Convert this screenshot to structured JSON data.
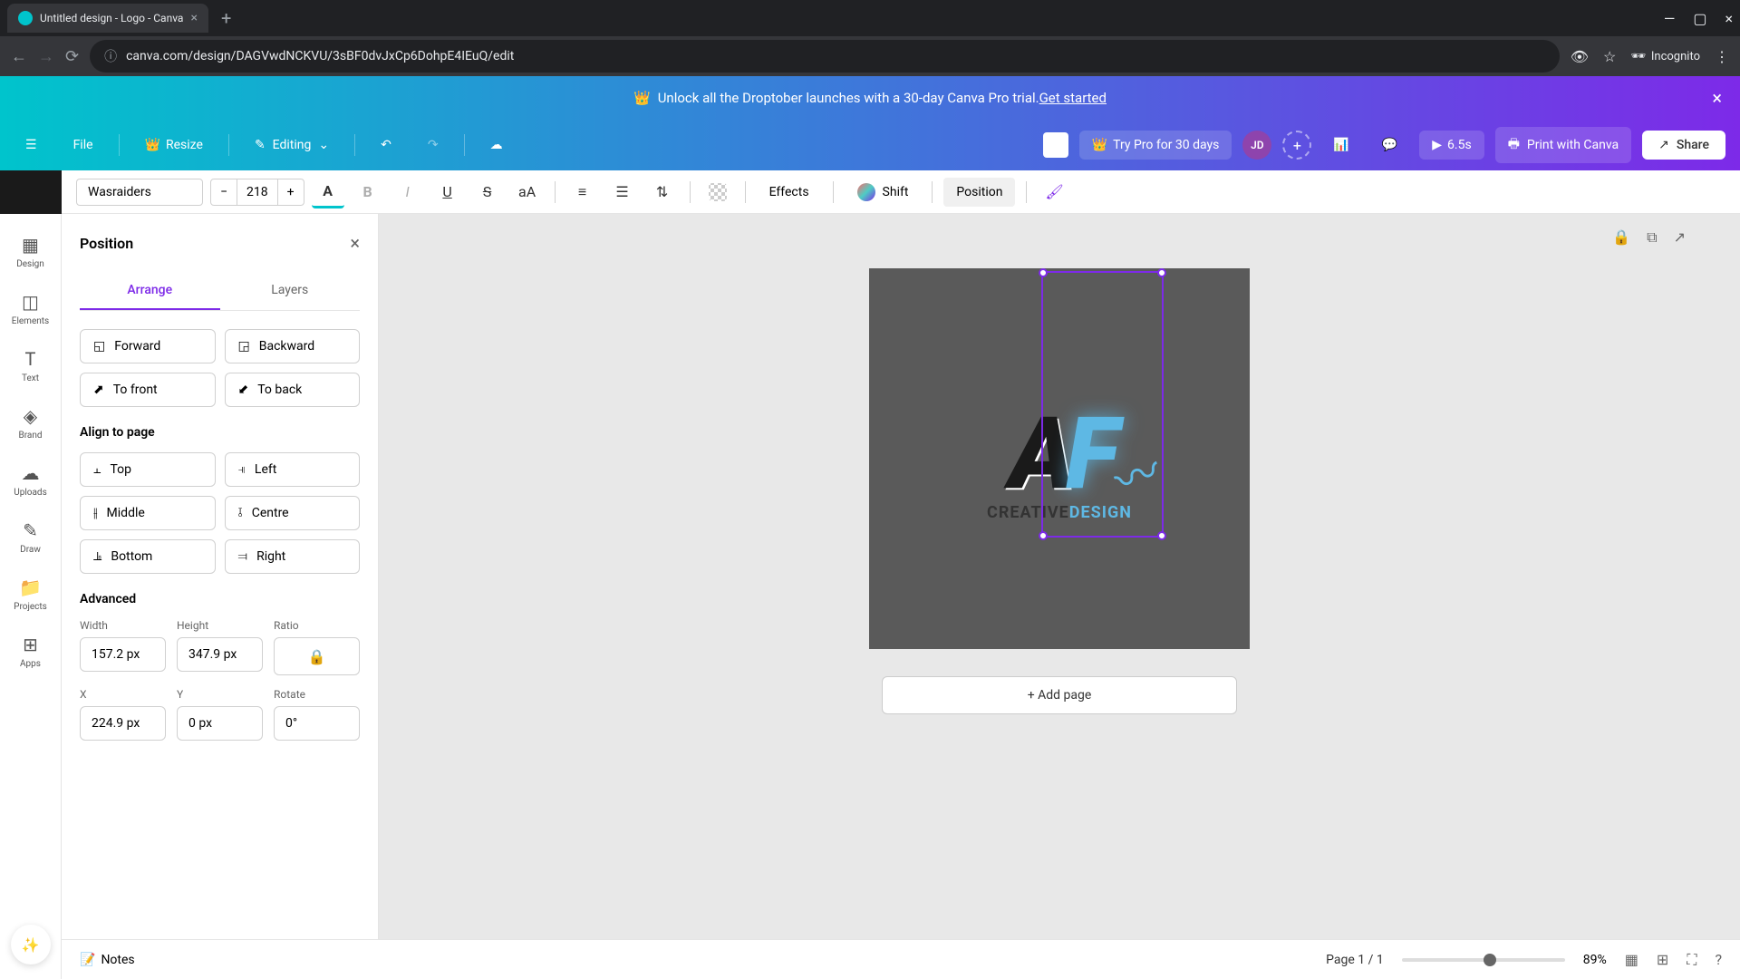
{
  "browser": {
    "tab_title": "Untitled design - Logo - Canva",
    "url": "canva.com/design/DAGVwdNCKVU/3sBF0dvJxCp6DohpE4IEuQ/edit",
    "incognito": "Incognito"
  },
  "banner": {
    "text": "Unlock all the Droptober launches with a 30-day Canva Pro trial. ",
    "cta": "Get started"
  },
  "toolbar": {
    "file": "File",
    "resize": "Resize",
    "editing": "Editing",
    "try_pro": "Try Pro for 30 days",
    "avatar": "JD",
    "duration": "6.5s",
    "print": "Print with Canva",
    "share": "Share"
  },
  "text_toolbar": {
    "font": "Wasraiders",
    "size": "218",
    "effects": "Effects",
    "shift": "Shift",
    "position": "Position"
  },
  "sidebar": {
    "items": [
      "Design",
      "Elements",
      "Text",
      "Brand",
      "Uploads",
      "Draw",
      "Projects",
      "Apps"
    ]
  },
  "panel": {
    "title": "Position",
    "tabs": [
      "Arrange",
      "Layers"
    ],
    "order": {
      "forward": "Forward",
      "backward": "Backward",
      "to_front": "To front",
      "to_back": "To back"
    },
    "align_section": "Align to page",
    "align": {
      "top": "Top",
      "left": "Left",
      "middle": "Middle",
      "centre": "Centre",
      "bottom": "Bottom",
      "right": "Right"
    },
    "advanced_section": "Advanced",
    "fields": {
      "width_label": "Width",
      "width": "157.2 px",
      "height_label": "Height",
      "height": "347.9 px",
      "ratio_label": "Ratio",
      "x_label": "X",
      "x": "224.9 px",
      "y_label": "Y",
      "y": "0 px",
      "rotate_label": "Rotate",
      "rotate": "0°"
    }
  },
  "canvas": {
    "logo_a": "A",
    "logo_f": "F",
    "sub_creative": "CREATIVE",
    "sub_design": "DESIGN",
    "add_page": "+ Add page"
  },
  "bottom": {
    "notes": "Notes",
    "page": "Page 1 / 1",
    "zoom": "89%"
  }
}
